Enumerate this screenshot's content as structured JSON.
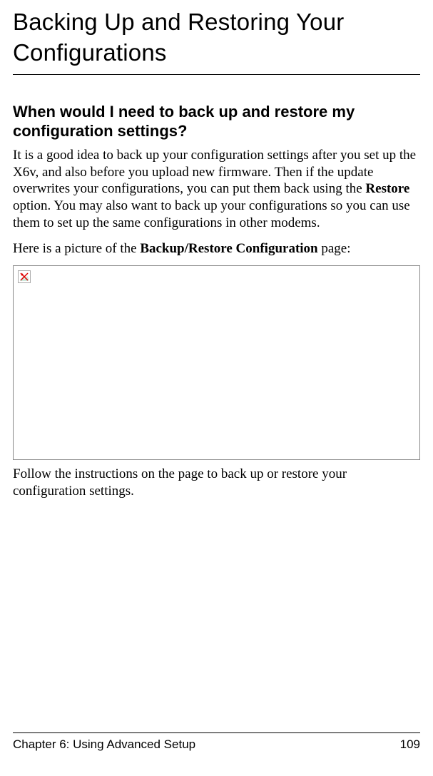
{
  "heading": "Backing Up and Restoring Your Configurations",
  "subheading": "When would I need to back up and restore my configuration settings?",
  "para1_pre": "It is a good idea to back up your configuration settings after you set up the X6v, and also before you upload new firmware. Then if the update overwrites your configurations, you can put them back using the ",
  "para1_bold": "Restore",
  "para1_post": " option. You may also want to back up your configurations so you can use them to set up the same configurations in other modems.",
  "para2_pre": "Here is a picture of the ",
  "para2_bold": "Backup/Restore Configuration",
  "para2_post": " page:",
  "para3": "Follow the instructions on the page to back up or restore your configuration settings.",
  "footer_left": "Chapter 6: Using Advanced Setup",
  "footer_right": "109"
}
